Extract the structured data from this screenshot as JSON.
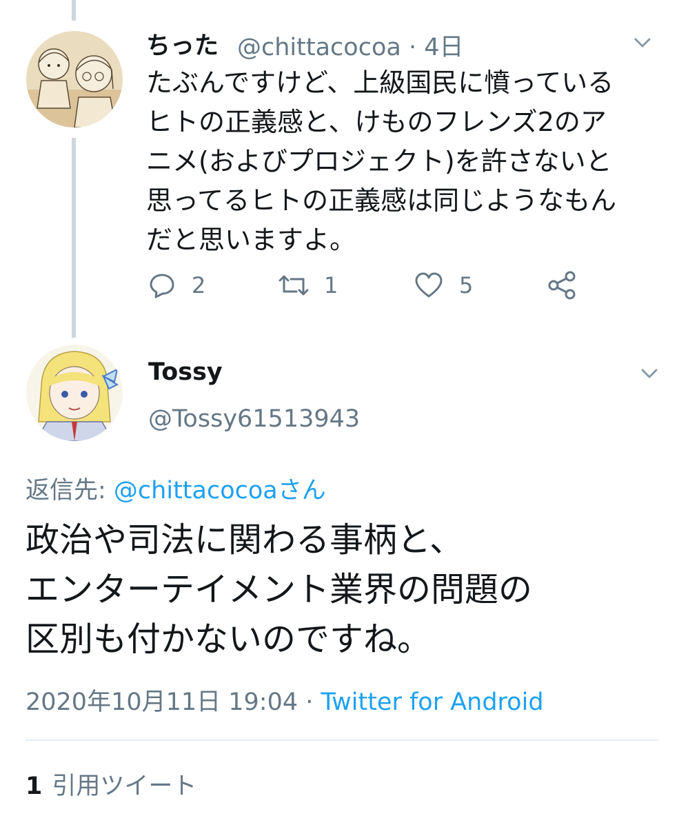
{
  "parent_tweet": {
    "display_name": "ちった",
    "handle": "@chittacocoa",
    "separator": "·",
    "time": "4日",
    "text": "たぶんですけど、上級国民に憤っている\nヒトの正義感と、けものフレンズ2のア\nニメ(およびプロジェクト)を許さないと\n思ってるヒトの正義感は同じようなもん\nだと思いますよ。",
    "actions": {
      "reply_count": "2",
      "retweet_count": "1",
      "like_count": "5"
    },
    "icons": [
      "reply-icon",
      "retweet-icon",
      "like-icon",
      "share-icon",
      "chevron-down-icon"
    ]
  },
  "main_tweet": {
    "display_name": "Tossy",
    "handle": "@Tossy61513943",
    "reply_to_prefix": "返信先: ",
    "reply_to_handle": "@chittacocoaさん",
    "text": "政治や司法に関わる事柄と、\nエンターテイメント業界の問題の\n区別も付かないのですね。",
    "date": "2020年10月11日 19:04",
    "separator": " · ",
    "client": "Twitter for Android",
    "quote_count": "1",
    "quote_label": "引用ツイート"
  },
  "colors": {
    "link": "#1da1f2",
    "secondary_text": "#657786",
    "primary_text": "#14171a",
    "thread_line": "#ccd6dd",
    "divider": "#e6ecf0"
  }
}
